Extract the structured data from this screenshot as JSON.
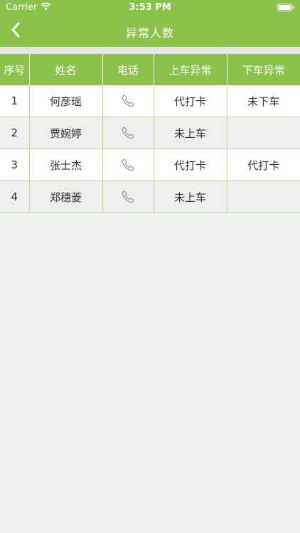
{
  "status_bar": {
    "carrier": "Carrier",
    "time": "3:53 PM",
    "icons": [
      "wifi-icon",
      "battery-icon"
    ]
  },
  "nav": {
    "title": "异常人数",
    "back_icon": "chevron-left-icon"
  },
  "colors": {
    "brand_green": "#8bc34a",
    "row_alt": "#eeeeee",
    "grid_line": "#b9db92"
  },
  "table": {
    "headers": [
      "序号",
      "姓名",
      "电话",
      "上车异常",
      "下车异常"
    ],
    "rows": [
      {
        "index": "1",
        "name": "何彦瑶",
        "phone_icon": "phone-icon",
        "board_issue": "代打卡",
        "alight_issue": "未下车"
      },
      {
        "index": "2",
        "name": "贾婉婷",
        "phone_icon": "phone-icon",
        "board_issue": "未上车",
        "alight_issue": ""
      },
      {
        "index": "3",
        "name": "张士杰",
        "phone_icon": "phone-icon",
        "board_issue": "代打卡",
        "alight_issue": "代打卡"
      },
      {
        "index": "4",
        "name": "郑穗菱",
        "phone_icon": "phone-icon",
        "board_issue": "未上车",
        "alight_issue": ""
      }
    ]
  }
}
